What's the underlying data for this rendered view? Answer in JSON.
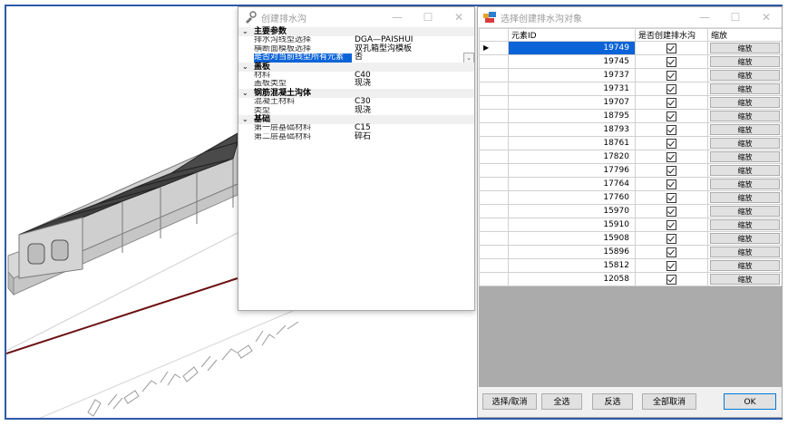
{
  "dialog1": {
    "title": "创建排水沟",
    "categories": [
      {
        "label": "主要参数",
        "props": [
          {
            "name": "排水沟线型选择",
            "value": "DGA—PAISHUI"
          },
          {
            "name": "横断面模板选择",
            "value": "双孔箱型沟模板"
          },
          {
            "name": "是否对当前线型所有元素",
            "value": "否"
          }
        ]
      },
      {
        "label": "盖板",
        "props": [
          {
            "name": "材料",
            "value": "C40"
          },
          {
            "name": "盖板类型",
            "value": "现浇"
          }
        ]
      },
      {
        "label": "钢筋混凝土沟体",
        "props": [
          {
            "name": "混凝土材料",
            "value": "C30"
          },
          {
            "name": "类型",
            "value": "现浇"
          }
        ]
      },
      {
        "label": "基础",
        "props": [
          {
            "name": "第一层基础材料",
            "value": "C15"
          },
          {
            "name": "第二层基础材料",
            "value": "碎石"
          }
        ]
      }
    ]
  },
  "dialog2": {
    "title": "选择创建排水沟对象",
    "columns": [
      "元素ID",
      "是否创建排水沟",
      "缩放"
    ],
    "zoom_label": "缩放",
    "rows": [
      "19749",
      "19745",
      "19737",
      "19731",
      "19707",
      "18795",
      "18793",
      "18761",
      "17820",
      "17796",
      "17764",
      "17760",
      "15970",
      "15910",
      "15908",
      "15896",
      "15812",
      "12058"
    ],
    "buttons": {
      "toggle": "选择/取消",
      "all": "全选",
      "invert": "反选",
      "cancel_all": "全部取消",
      "ok": "OK"
    }
  },
  "window_controls": {
    "minimize": "—",
    "maximize": "☐",
    "close": "✕"
  },
  "colors": {
    "accent": "#0b63d8",
    "frame": "#2e5aa8",
    "alignment_line": "#6b1010"
  }
}
